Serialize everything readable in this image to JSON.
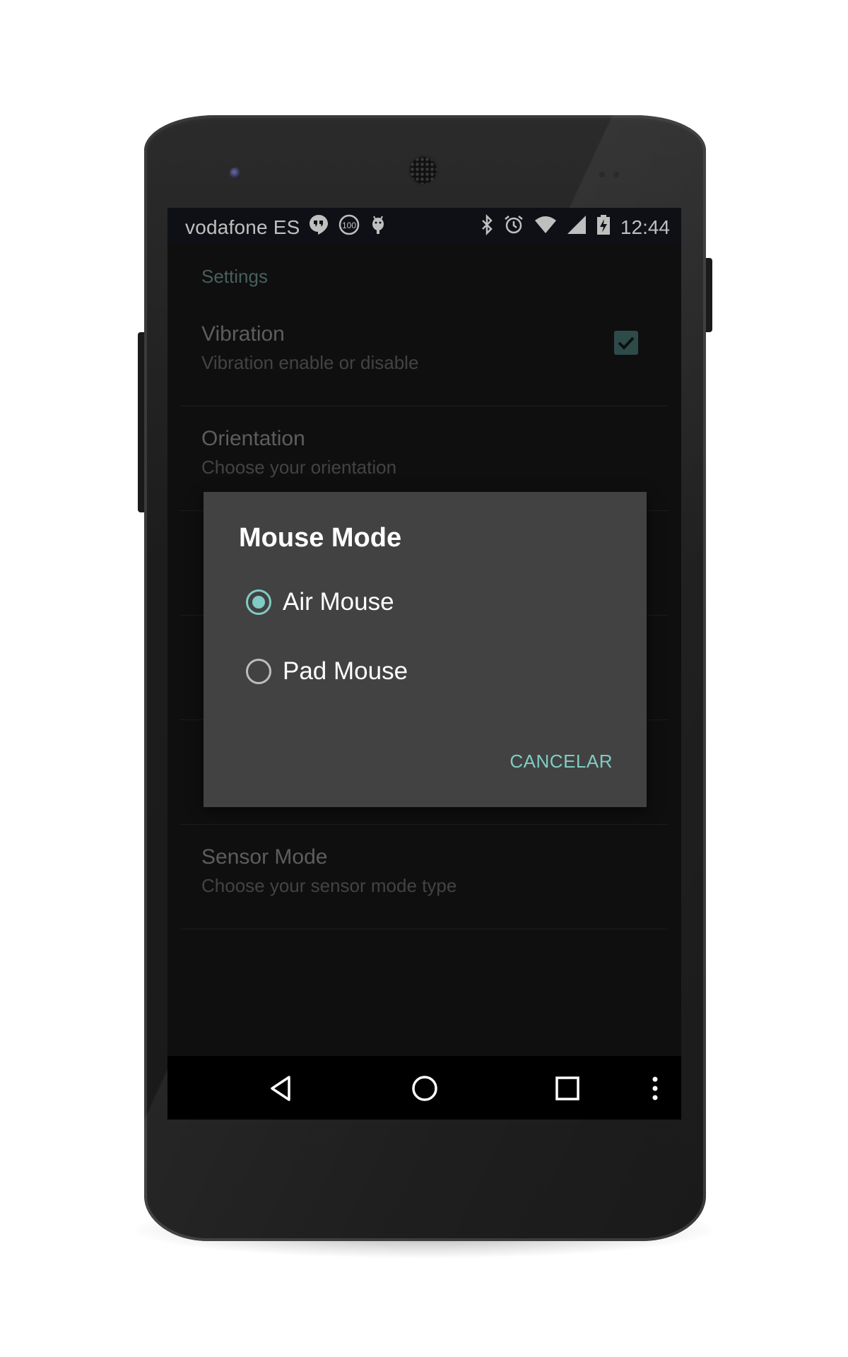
{
  "status_bar": {
    "carrier": "vodafone ES",
    "battery_badge": "100",
    "time": "12:44",
    "left_icons": [
      "hangouts-icon",
      "battery-badge-icon",
      "android-debug-icon"
    ],
    "right_icons": [
      "bluetooth-icon",
      "alarm-icon",
      "wifi-icon",
      "signal-icon",
      "battery-charging-icon"
    ]
  },
  "settings": {
    "section_title": "Settings",
    "items": [
      {
        "title": "Vibration",
        "summary": "Vibration enable or disable",
        "checked": true
      },
      {
        "title": "Orientation",
        "summary": "Choose your orientation"
      },
      {
        "title": "Sensor Mode",
        "summary": "Choose your sensor mode type"
      }
    ]
  },
  "dialog": {
    "title": "Mouse Mode",
    "options": [
      {
        "label": "Air Mouse",
        "selected": true
      },
      {
        "label": "Pad Mouse",
        "selected": false
      }
    ],
    "cancel_label": "CANCELAR"
  },
  "nav_bar": {
    "icons": [
      "back-icon",
      "home-icon",
      "recents-icon",
      "overflow-menu-icon"
    ]
  },
  "colors": {
    "accent": "#80cbc4",
    "dialog_bg": "#424242",
    "screen_bg": "#151515",
    "section_title": "#5f7f7c"
  }
}
